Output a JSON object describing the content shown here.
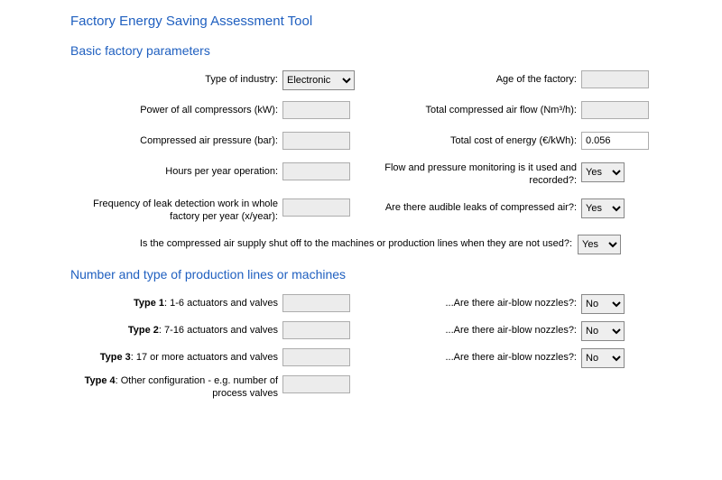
{
  "title": "Factory Energy Saving Assessment Tool",
  "section1": {
    "header": "Basic factory parameters",
    "industry": {
      "label": "Type of industry:",
      "value": "Electronic"
    },
    "age": {
      "label": "Age of the factory:",
      "value": ""
    },
    "power": {
      "label": "Power of all compressors (kW):",
      "value": ""
    },
    "flow": {
      "label": "Total compressed air flow (Nm³/h):",
      "value": ""
    },
    "pressure": {
      "label": "Compressed air pressure (bar):",
      "value": ""
    },
    "cost": {
      "label": "Total cost of energy (€/kWh):",
      "value": "0.056"
    },
    "hours": {
      "label": "Hours per year operation:",
      "value": ""
    },
    "monitoring": {
      "label": "Flow and pressure monitoring is it used and recorded?:",
      "value": "Yes"
    },
    "leakfreq": {
      "label": "Frequency of leak detection work in whole factory per year (x/year):",
      "value": ""
    },
    "audible": {
      "label": "Are there audible leaks of compressed air?:",
      "value": "Yes"
    },
    "shutoff": {
      "label": "Is the compressed air supply shut off to the machines or production lines when they are not used?:",
      "value": "Yes"
    }
  },
  "section2": {
    "header": "Number and type of production lines or machines",
    "types": [
      {
        "bold": "Type 1",
        "desc": ": 1-6 actuators and valves",
        "value": "",
        "nozzle_label": "...Are there air-blow nozzles?:",
        "nozzle_value": "No"
      },
      {
        "bold": "Type 2",
        "desc": ": 7-16 actuators and valves",
        "value": "",
        "nozzle_label": "...Are there air-blow nozzles?:",
        "nozzle_value": "No"
      },
      {
        "bold": "Type 3",
        "desc": ": 17 or more actuators and valves",
        "value": "",
        "nozzle_label": "...Are there air-blow nozzles?:",
        "nozzle_value": "No"
      },
      {
        "bold": "Type 4",
        "desc": ": Other configuration - e.g. number of process valves",
        "value": ""
      }
    ]
  },
  "options": {
    "yes": "Yes",
    "no": "No"
  }
}
